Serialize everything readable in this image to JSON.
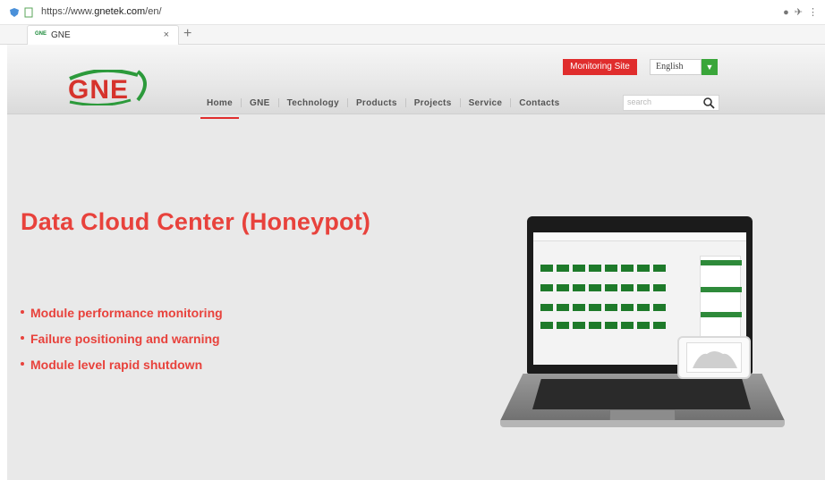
{
  "browser": {
    "url_prefix": "https://www.",
    "url_domain": "gnetek.com",
    "url_path": "/en/",
    "tab_title": "GNE",
    "tab_close": "×",
    "new_tab": "+"
  },
  "header": {
    "logo_text": "GNE",
    "monitoring_site_label": "Monitoring Site",
    "language_value": "English",
    "language_dropdown_icon": "chevron-down-icon",
    "nav": [
      "Home",
      "GNE",
      "Technology",
      "Products",
      "Projects",
      "Service",
      "Contacts"
    ],
    "search_placeholder": "search"
  },
  "hero": {
    "title": "Data Cloud Center (Honeypot)",
    "features": [
      "Module performance monitoring",
      "Failure positioning and warning",
      "Module level rapid shutdown"
    ]
  },
  "colors": {
    "accent_red": "#e8423c",
    "brand_green": "#3aa63a",
    "button_red": "#e02d2d"
  }
}
